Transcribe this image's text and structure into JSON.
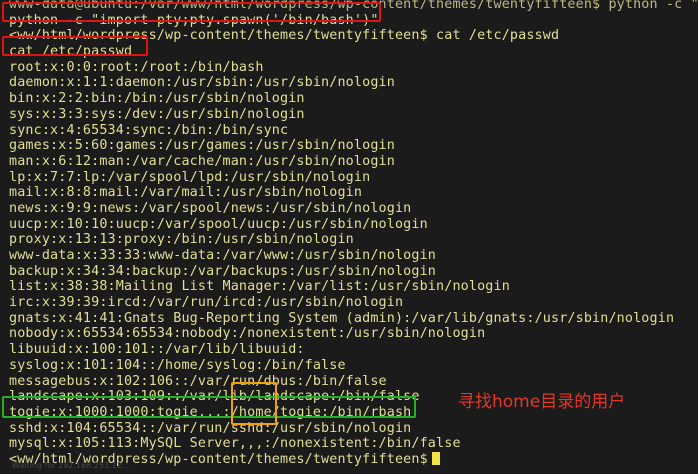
{
  "terminal": {
    "lines": [
      "www-data@ubuntu:/var/www/html/wordpress/wp-content/themes/twentyfifteen$ python -c \"import pty;pty.spawn('/bin/bash')\"",
      "python -c \"import pty;pty.spawn('/bin/bash')\"",
      "<ww/html/wordpress/wp-content/themes/twentyfifteen$ cat /etc/passwd",
      "cat /etc/passwd",
      "root:x:0:0:root:/root:/bin/bash",
      "daemon:x:1:1:daemon:/usr/sbin:/usr/sbin/nologin",
      "bin:x:2:2:bin:/bin:/usr/sbin/nologin",
      "sys:x:3:3:sys:/dev:/usr/sbin/nologin",
      "sync:x:4:65534:sync:/bin:/bin/sync",
      "games:x:5:60:games:/usr/games:/usr/sbin/nologin",
      "man:x:6:12:man:/var/cache/man:/usr/sbin/nologin",
      "lp:x:7:7:lp:/var/spool/lpd:/usr/sbin/nologin",
      "mail:x:8:8:mail:/var/mail:/usr/sbin/nologin",
      "news:x:9:9:news:/var/spool/news:/usr/sbin/nologin",
      "uucp:x:10:10:uucp:/var/spool/uucp:/usr/sbin/nologin",
      "proxy:x:13:13:proxy:/bin:/usr/sbin/nologin",
      "www-data:x:33:33:www-data:/var/www:/usr/sbin/nologin",
      "backup:x:34:34:backup:/var/backups:/usr/sbin/nologin",
      "list:x:38:38:Mailing List Manager:/var/list:/usr/sbin/nologin",
      "irc:x:39:39:ircd:/var/run/ircd:/usr/sbin/nologin",
      "gnats:x:41:41:Gnats Bug-Reporting System (admin):/var/lib/gnats:/usr/sbin/nologin",
      "nobody:x:65534:65534:nobody:/nonexistent:/usr/sbin/nologin",
      "libuuid:x:100:101::/var/lib/libuuid:",
      "syslog:x:101:104::/home/syslog:/bin/false",
      "messagebus:x:102:106::/var/run/dbus:/bin/false",
      "landscape:x:103:109::/var/lib/landscape:/bin/false",
      "togie:x:1000:1000:togie,,,:/home/togie:/bin/rbash",
      "sshd:x:104:65534::/var/run/sshd:/usr/sbin/nologin",
      "mysql:x:105:113:MySQL Server,,,:/nonexistent:/bin/false",
      "<ww/html/wordpress/wp-content/themes/twentyfifteen$"
    ]
  },
  "annotation": {
    "text": "寻找home目录的用户",
    "color": "#e0382a"
  },
  "highlight_colors": {
    "command": "#e11414",
    "user_line": "#21b023",
    "home_dir": "#f0a20a"
  },
  "footer": {
    "text": "Waiting for 192.168.253.12..."
  }
}
